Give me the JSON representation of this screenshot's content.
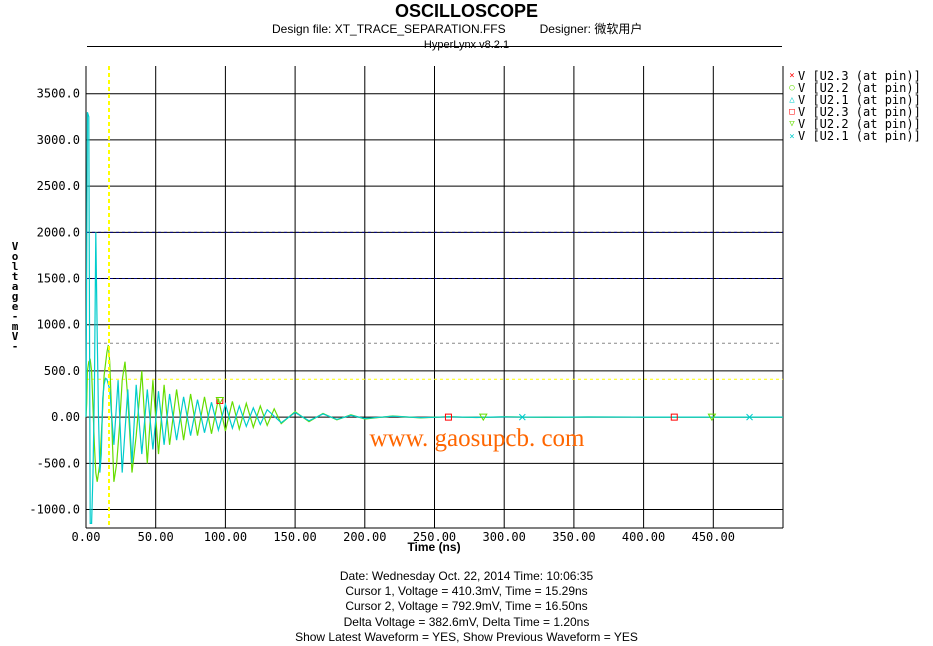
{
  "header": {
    "title": "OSCILLOSCOPE",
    "design_file": "Design file: XT_TRACE_SEPARATION.FFS",
    "designer": "Designer: 微软用户",
    "version": "HyperLynx v8.2.1"
  },
  "footer": {
    "date_line": "Date: Wednesday Oct. 22, 2014   Time: 10:06:35",
    "cursor1_line": "Cursor 1, Voltage = 410.3mV, Time = 15.29ns",
    "cursor2_line": "Cursor 2, Voltage = 792.9mV, Time = 16.50ns",
    "delta_line": "Delta Voltage = 382.6mV,    Delta Time = 1.20ns",
    "show_line": "Show Latest Waveform = YES,    Show Previous Waveform = YES"
  },
  "watermark": "www. gaosupcb. com",
  "colors": {
    "grid": "#000000",
    "cursor_vertical": "#ffff00",
    "u23": "#ff0000",
    "u22": "#66dd00",
    "u21": "#00cccc",
    "watermark": "#ff6600",
    "ref_blue": "#000080",
    "ref_gray": "#888888"
  },
  "chart_data": {
    "type": "line",
    "title": "OSCILLOSCOPE",
    "xlabel": "Time (ns)",
    "ylabel": "Voltage -mV-",
    "xlim": [
      0,
      500
    ],
    "ylim": [
      -1200,
      3800
    ],
    "x_ticks": [
      0,
      50,
      100,
      150,
      200,
      250,
      300,
      350,
      400,
      450
    ],
    "x_tick_labels": [
      "0.00",
      "50.00",
      "100.00",
      "150.00",
      "200.00",
      "250.00",
      "300.00",
      "350.00",
      "400.00",
      "450.00"
    ],
    "y_ticks": [
      -1000,
      -500,
      0,
      500,
      1000,
      1500,
      2000,
      2500,
      3000,
      3500
    ],
    "y_tick_labels": [
      "-1000.0",
      "-500.0",
      "0.00",
      "500.0",
      "1000.0",
      "1500.0",
      "2000.0",
      "2500.0",
      "3000.0",
      "3500.0"
    ],
    "grid": true,
    "legend_position": "right",
    "reference_lines": [
      {
        "y": 2000,
        "style": "dashed",
        "color": "#000080"
      },
      {
        "y": 1500,
        "style": "dashed",
        "color": "#000080"
      },
      {
        "y": 800,
        "style": "dashed",
        "color": "#888888"
      },
      {
        "y": 410,
        "style": "dashed",
        "color": "#ffff00"
      }
    ],
    "cursor_x": 16.5,
    "series": [
      {
        "name": "V [U2.3 (at pin)]",
        "marker": "×",
        "color": "#ff0000",
        "marker_x": [],
        "marker_y": []
      },
      {
        "name": "V [U2.2 (at pin)]",
        "marker": "○",
        "color": "#66dd00",
        "marker_x": [],
        "marker_y": []
      },
      {
        "name": "V [U2.1 (at pin)]",
        "marker": "△",
        "color": "#00cccc",
        "marker_x": [],
        "marker_y": []
      },
      {
        "name": "V [U2.3 (at pin)]",
        "marker": "□",
        "color": "#ff0000",
        "marker_x": [
          96,
          260,
          422
        ],
        "marker_y": [
          180,
          0,
          0
        ]
      },
      {
        "name": "V [U2.2 (at pin)]",
        "marker": "▽",
        "color": "#66dd00",
        "x": [
          0,
          0.5,
          1,
          2,
          3,
          4,
          5,
          6,
          7,
          8,
          10,
          12,
          13,
          15,
          16,
          17,
          18,
          19,
          20,
          22,
          24,
          26,
          28,
          30,
          33,
          36,
          40,
          44,
          48,
          52,
          56,
          60,
          65,
          70,
          75,
          80,
          85,
          90,
          95,
          100,
          105,
          110,
          115,
          120,
          125,
          130,
          135,
          140,
          150,
          160,
          170,
          180,
          190,
          200,
          220,
          240,
          260,
          280,
          300,
          330,
          360,
          400,
          440,
          480,
          500
        ],
        "y": [
          0,
          150,
          500,
          600,
          620,
          500,
          100,
          -300,
          -600,
          -700,
          -500,
          100,
          450,
          700,
          780,
          600,
          200,
          -300,
          -700,
          -500,
          -100,
          400,
          600,
          200,
          -600,
          -200,
          500,
          -500,
          400,
          -400,
          350,
          -300,
          300,
          -250,
          250,
          -200,
          220,
          -180,
          200,
          -150,
          170,
          -130,
          150,
          -110,
          120,
          -90,
          90,
          -70,
          60,
          -50,
          40,
          -30,
          25,
          -20,
          12,
          -8,
          5,
          -4,
          3,
          -2,
          1,
          0,
          0,
          0,
          0
        ],
        "marker_x": [
          96,
          285,
          449
        ],
        "marker_y": [
          180,
          0,
          0
        ]
      },
      {
        "name": "V [U2.1 (at pin)]",
        "marker": "×",
        "color": "#00cccc",
        "x": [
          0,
          1,
          2,
          3,
          4,
          5,
          6,
          7,
          8,
          9,
          10,
          11,
          12,
          13,
          14,
          15,
          17,
          20,
          23,
          26,
          30,
          33,
          36,
          40,
          44,
          48,
          52,
          56,
          60,
          65,
          70,
          75,
          80,
          85,
          90,
          95,
          100,
          105,
          110,
          115,
          120,
          125,
          130,
          140,
          150,
          160,
          170,
          180,
          190,
          200,
          220,
          240,
          260,
          280,
          300,
          330,
          360,
          400,
          440,
          480,
          500
        ],
        "y": [
          0,
          3300,
          3250,
          -1150,
          -1150,
          -600,
          300,
          2000,
          900,
          0,
          -600,
          -400,
          200,
          350,
          420,
          410,
          300,
          -300,
          400,
          -600,
          300,
          -500,
          350,
          -400,
          300,
          -350,
          280,
          -300,
          250,
          -250,
          220,
          -200,
          190,
          -170,
          160,
          -140,
          140,
          -120,
          120,
          -100,
          100,
          -80,
          80,
          -60,
          50,
          -40,
          35,
          -25,
          20,
          -15,
          10,
          -6,
          4,
          -3,
          2,
          -1,
          1,
          0,
          0,
          0,
          0
        ],
        "marker_x": [
          313,
          476
        ],
        "marker_y": [
          0,
          0
        ]
      }
    ]
  }
}
